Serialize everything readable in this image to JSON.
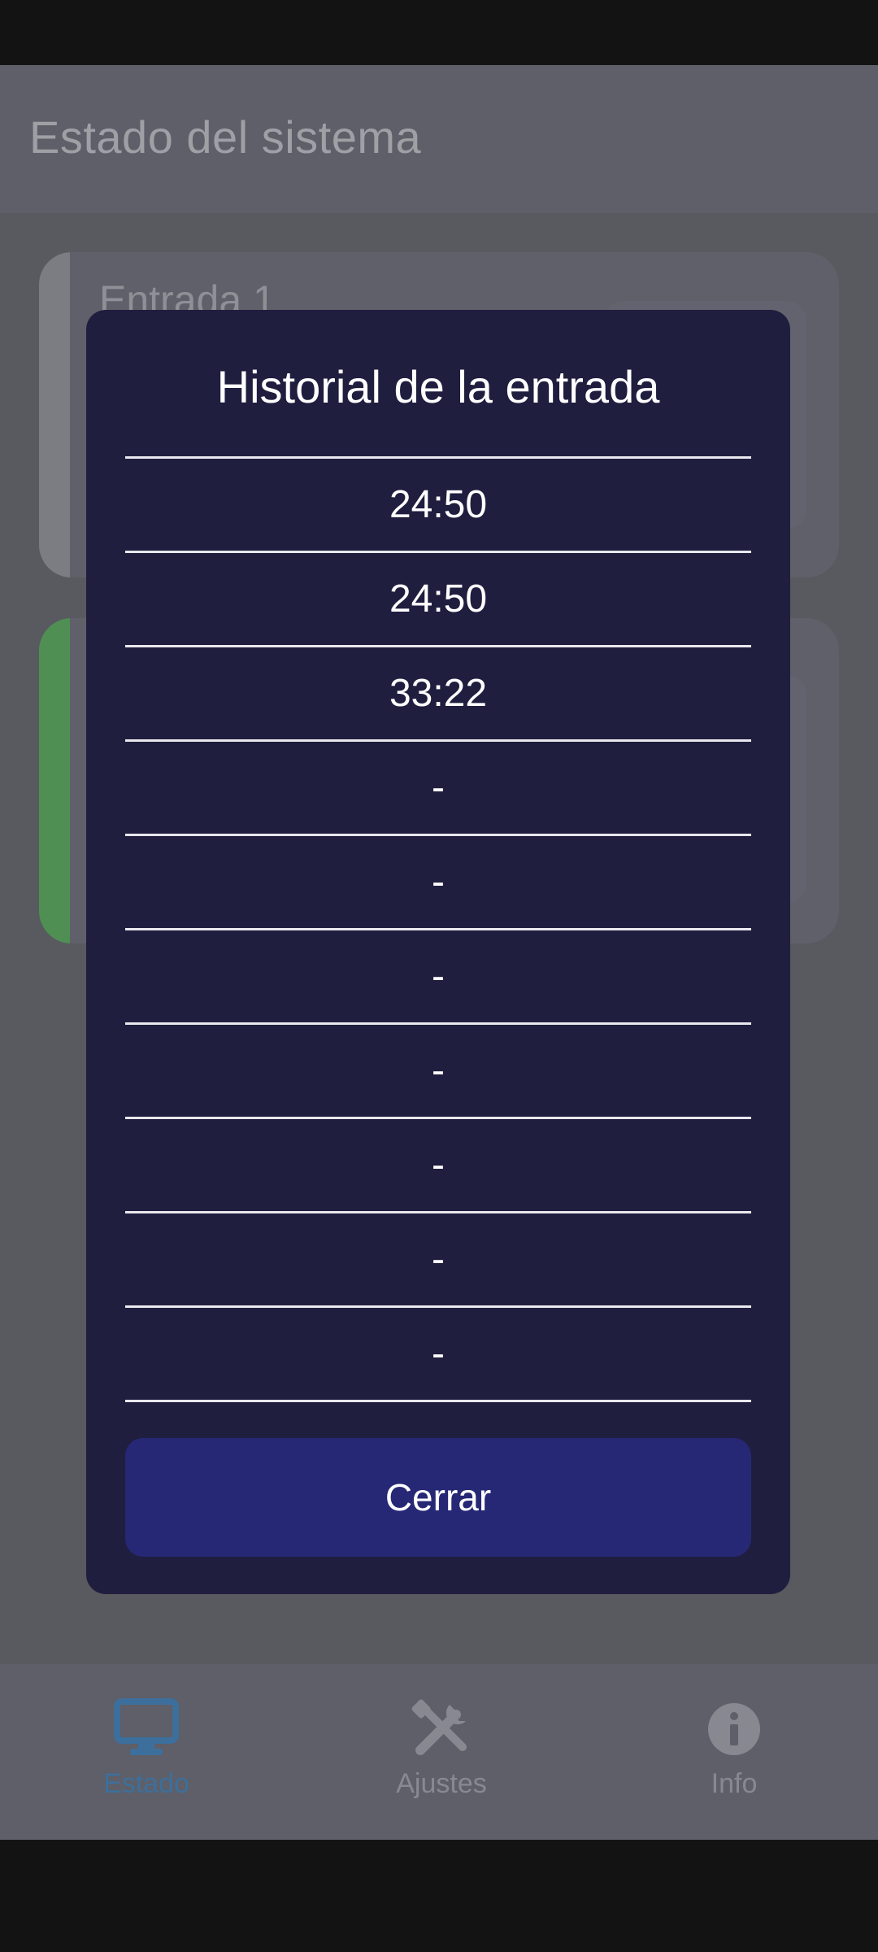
{
  "app": {
    "title": "Estado del sistema"
  },
  "cards": [
    {
      "title": "Entrada 1",
      "accent": "#7c7d82"
    },
    {
      "title": "",
      "accent": "#4f8f53"
    }
  ],
  "dialog": {
    "title": "Historial de la entrada",
    "history": [
      "24:50",
      "24:50",
      "33:22",
      "-",
      "-",
      "-",
      "-",
      "-",
      "-",
      "-"
    ],
    "close_label": "Cerrar"
  },
  "bottom_nav": {
    "items": [
      {
        "label": "Estado",
        "icon": "monitor-icon",
        "active": true,
        "color": "#3d6f9c"
      },
      {
        "label": "Ajustes",
        "icon": "tools-icon",
        "active": false
      },
      {
        "label": "Info",
        "icon": "info-icon",
        "active": false
      }
    ]
  },
  "colors": {
    "dialog_bg": "#1f1e3f",
    "button_bg": "#262875",
    "scrim": "#585a5f"
  }
}
